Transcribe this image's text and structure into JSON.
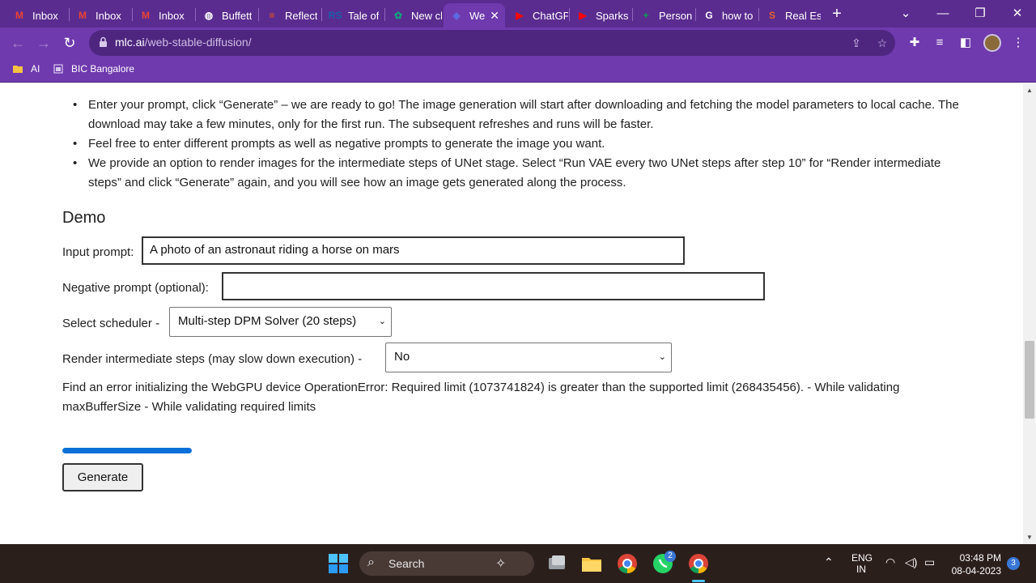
{
  "browser": {
    "tabs": [
      {
        "title": "Inbox",
        "icon": "gmail-icon",
        "color": "#ea4335",
        "glyph": "M"
      },
      {
        "title": "Inbox",
        "icon": "gmail-icon",
        "color": "#ea4335",
        "glyph": "M"
      },
      {
        "title": "Inbox",
        "icon": "gmail-icon",
        "color": "#ea4335",
        "glyph": "M"
      },
      {
        "title": "Buffett",
        "icon": "globe-icon",
        "color": "#ffffff",
        "glyph": "◍"
      },
      {
        "title": "Reflect",
        "icon": "reflect-icon",
        "color": "#f2561d",
        "glyph": "≡"
      },
      {
        "title": "Tale of",
        "icon": "rs-icon",
        "color": "#1b5fa8",
        "glyph": "RS"
      },
      {
        "title": "New ch",
        "icon": "chatgpt-icon",
        "color": "#10a37f",
        "glyph": "✿"
      },
      {
        "title": "We",
        "icon": "webllm-icon",
        "color": "#5b6ee1",
        "glyph": "◈"
      },
      {
        "title": "ChatGP",
        "icon": "youtube-icon",
        "color": "#ff0000",
        "glyph": "▶"
      },
      {
        "title": "Sparks",
        "icon": "youtube-icon",
        "color": "#ff0000",
        "glyph": "▶"
      },
      {
        "title": "Person",
        "icon": "sheets-icon",
        "color": "#0f9d58",
        "glyph": "+"
      },
      {
        "title": "how to",
        "icon": "google-icon",
        "color": "#ffffff",
        "glyph": "G"
      },
      {
        "title": "Real Es",
        "icon": "s-icon",
        "color": "#e0622b",
        "glyph": "S"
      }
    ],
    "active_tab_close": "✕",
    "new_tab": "+",
    "url_domain": "mlc.ai",
    "url_path": "/web-stable-diffusion/",
    "bookmarks": [
      {
        "label": "AI",
        "icon": "folder-icon"
      },
      {
        "label": "BIC Bangalore",
        "icon": "page-icon"
      }
    ]
  },
  "page": {
    "bullets": [
      "Enter your prompt, click “Generate” – we are ready to go! The image generation will start after downloading and fetching the model parameters to local cache. The download may take a few minutes, only for the first run. The subsequent refreshes and runs will be faster.",
      "Feel free to enter different prompts as well as negative prompts to generate the image you want.",
      "We provide an option to render images for the intermediate steps of UNet stage. Select “Run VAE every two UNet steps after step 10” for “Render intermediate steps” and click “Generate” again, and you will see how an image gets generated along the process."
    ],
    "demo_title": "Demo",
    "input_prompt_label": "Input prompt:",
    "input_prompt_value": "A photo of an astronaut riding a horse on mars",
    "negative_prompt_label": "Negative prompt (optional):",
    "negative_prompt_value": "",
    "scheduler_label": "Select scheduler -",
    "scheduler_value": "Multi-step DPM Solver (20 steps)",
    "render_label": "Render intermediate steps (may slow down execution) -",
    "render_value": "No",
    "error_text": "Find an error initializing the WebGPU device OperationError: Required limit (1073741824) is greater than the supported limit (268435456). - While validating maxBufferSize - While validating required limits",
    "progress": 1.0,
    "progress_color": "#0a6fd8",
    "generate_label": "Generate"
  },
  "taskbar": {
    "search_label": "Search",
    "lang_top": "ENG",
    "lang_bottom": "IN",
    "time": "03:48 PM",
    "date": "08-04-2023",
    "notification_count": "3",
    "whatsapp_badge": "2"
  }
}
